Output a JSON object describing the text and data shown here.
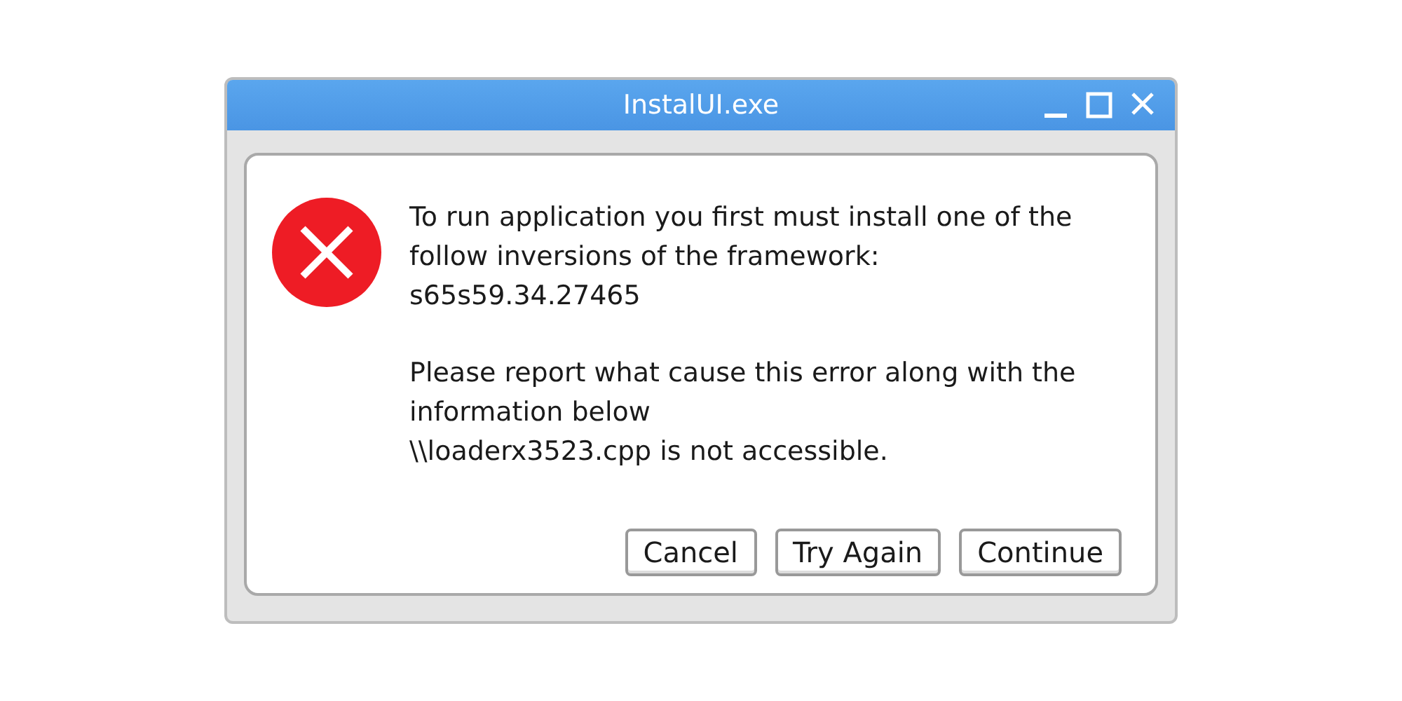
{
  "window": {
    "title": "InstalUI.exe"
  },
  "message": {
    "paragraphs": [
      [
        "To run application you first must install one of the follow inversions of the framework:",
        "s65s59.34.27465"
      ],
      [
        "Please report what cause this error along with the information below",
        "\\\\loaderx3523.cpp is not accessible."
      ]
    ]
  },
  "buttons": [
    "Cancel",
    "Try Again",
    "Continue"
  ]
}
